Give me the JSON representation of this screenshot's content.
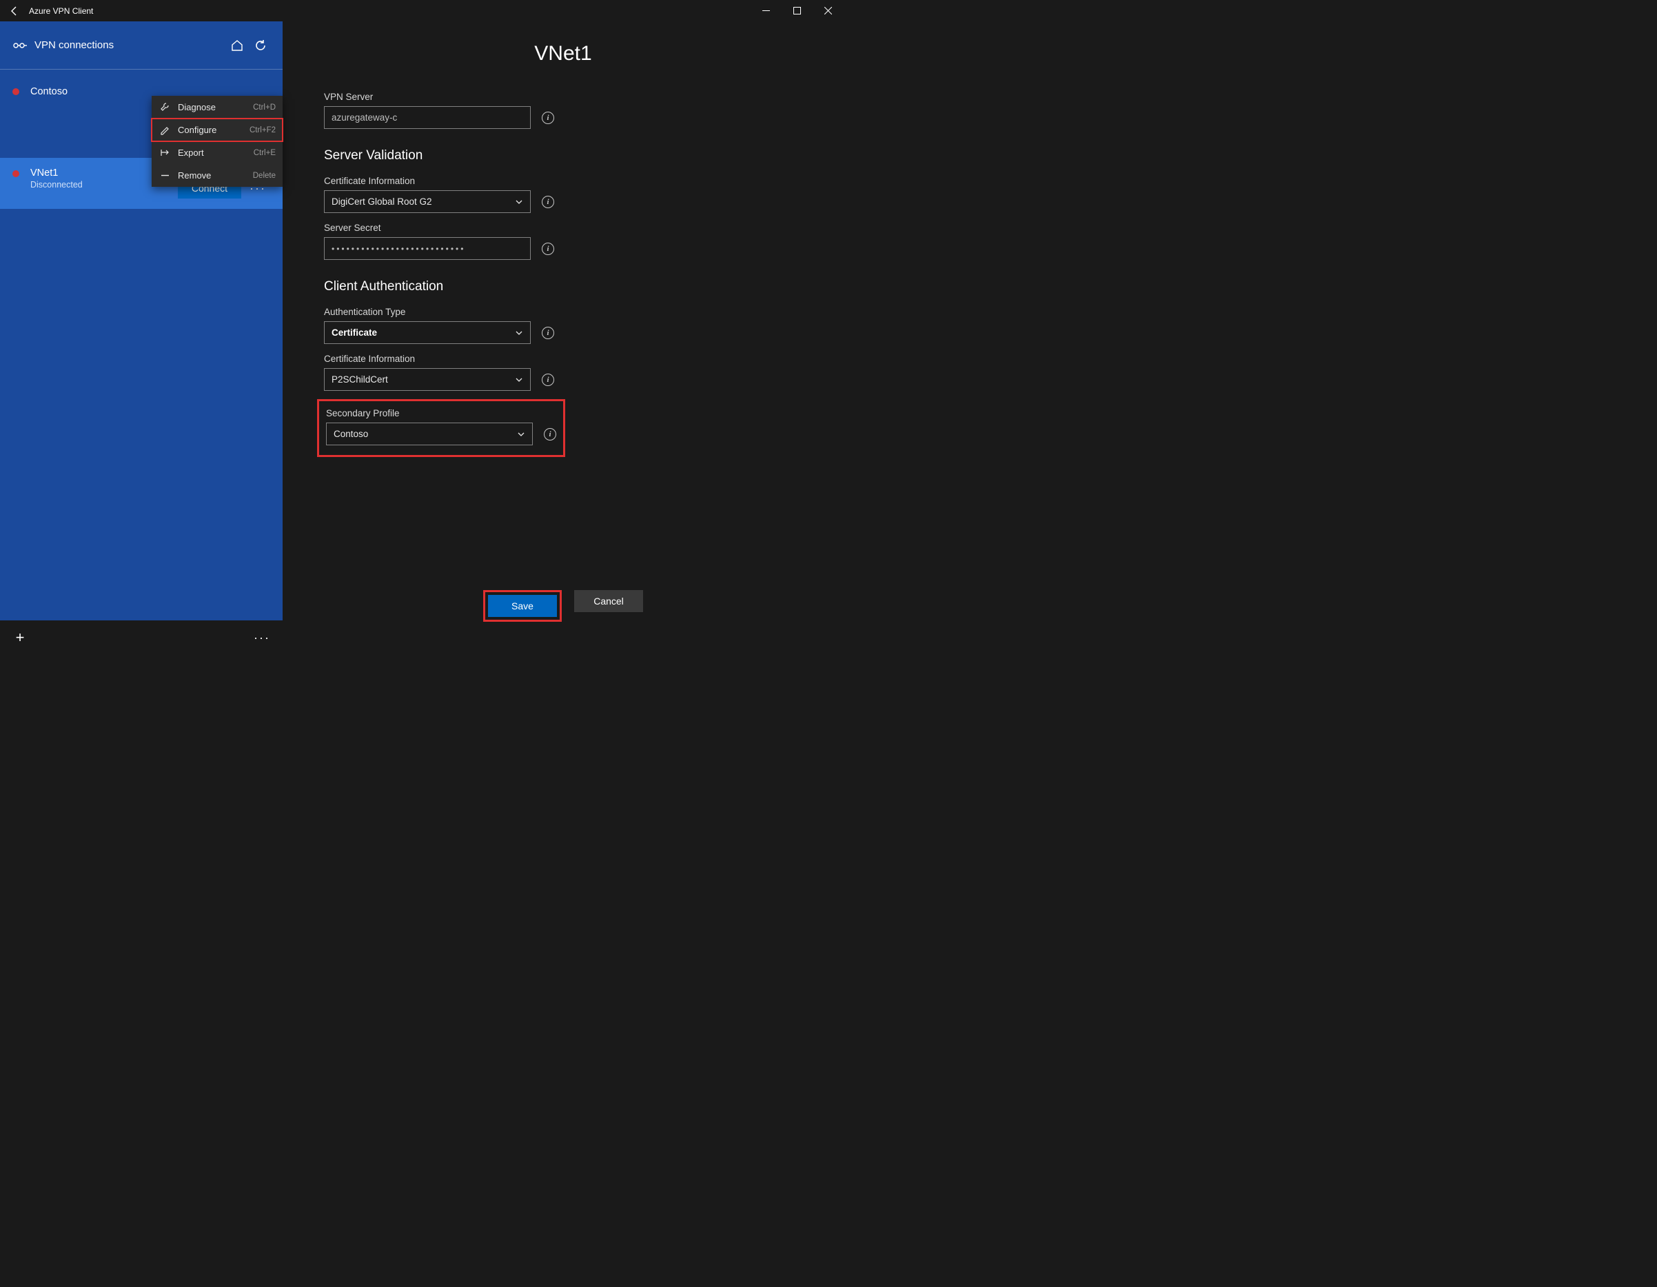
{
  "titlebar": {
    "app_title": "Azure VPN Client"
  },
  "sidebar": {
    "header_label": "VPN connections",
    "items": [
      {
        "name": "Contoso",
        "status": ""
      },
      {
        "name": "VNet1",
        "status": "Disconnected"
      }
    ],
    "connect_label": "Connect"
  },
  "context_menu": {
    "items": [
      {
        "label": "Diagnose",
        "shortcut": "Ctrl+D"
      },
      {
        "label": "Configure",
        "shortcut": "Ctrl+F2"
      },
      {
        "label": "Export",
        "shortcut": "Ctrl+E"
      },
      {
        "label": "Remove",
        "shortcut": "Delete"
      }
    ]
  },
  "main": {
    "title": "VNet1",
    "vpn_server_label": "VPN Server",
    "vpn_server_value": "azuregateway-c",
    "server_validation_label": "Server Validation",
    "cert_info_label": "Certificate Information",
    "cert_info_value": "DigiCert Global Root G2",
    "server_secret_label": "Server Secret",
    "server_secret_value": "•••••••••••••••••••••••••••",
    "client_auth_label": "Client Authentication",
    "auth_type_label": "Authentication Type",
    "auth_type_value": "Certificate",
    "client_cert_info_label": "Certificate Information",
    "client_cert_info_value": "P2SChildCert",
    "secondary_profile_label": "Secondary Profile",
    "secondary_profile_value": "Contoso",
    "save_label": "Save",
    "cancel_label": "Cancel"
  }
}
